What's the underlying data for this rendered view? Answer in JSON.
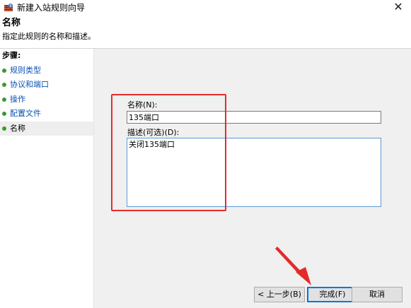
{
  "window": {
    "title": "新建入站规则向导",
    "close_symbol": "✕"
  },
  "header": {
    "title": "名称",
    "subtitle": "指定此规则的名称和描述。"
  },
  "steps": {
    "heading": "步骤:",
    "items": [
      {
        "label": "规则类型",
        "current": false
      },
      {
        "label": "协议和端口",
        "current": false
      },
      {
        "label": "操作",
        "current": false
      },
      {
        "label": "配置文件",
        "current": false
      },
      {
        "label": "名称",
        "current": true
      }
    ]
  },
  "form": {
    "name_label": "名称(N):",
    "name_value": "135端口",
    "description_label": "描述(可选)(D):",
    "description_value": "关闭135端口"
  },
  "buttons": {
    "back_label": "< 上一步(B)",
    "finish_label": "完成(F)",
    "cancel_label": "取消"
  },
  "colors": {
    "annotation": "#e32b2b",
    "step_link": "#0b52b3",
    "step_bullet": "#3a9b2c",
    "focus": "#0078d7"
  },
  "icons": {
    "app": "firewall-icon",
    "close": "close-icon",
    "bullet": "bullet-icon"
  }
}
